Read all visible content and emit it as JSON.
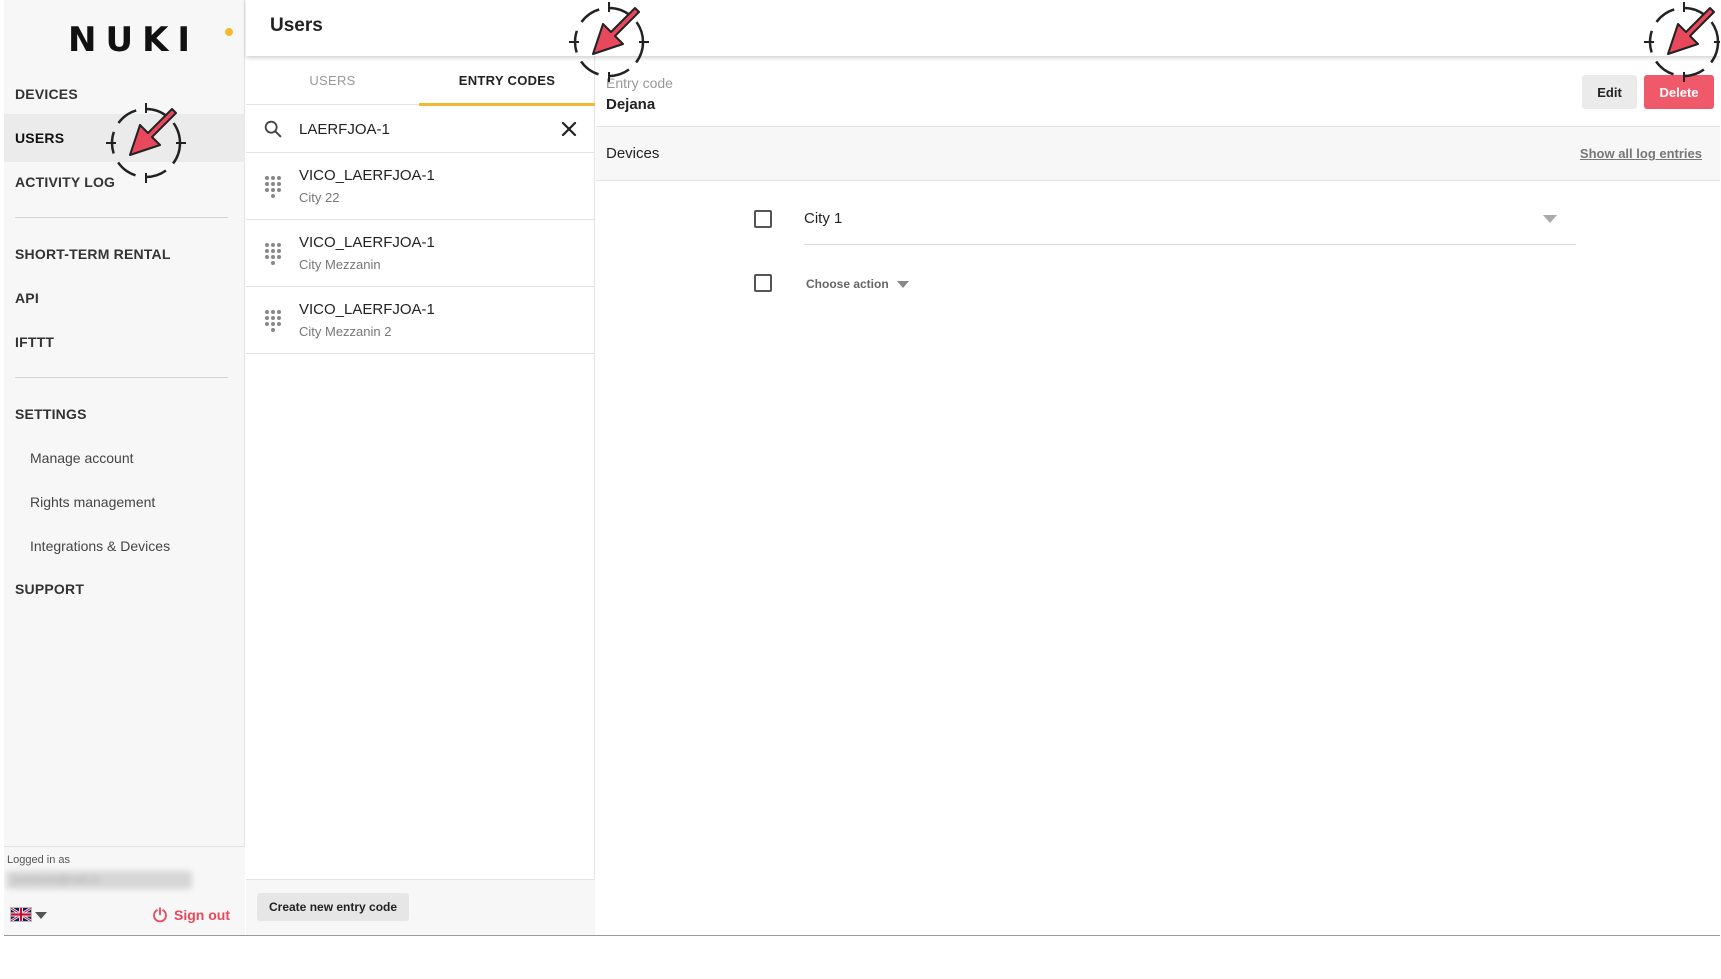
{
  "app": {
    "logo": "NUKI"
  },
  "sidebar": {
    "items": [
      {
        "label": "DEVICES",
        "active": false
      },
      {
        "label": "USERS",
        "active": true
      },
      {
        "label": "ACTIVITY LOG",
        "active": false
      },
      {
        "label": "SHORT-TERM RENTAL",
        "active": false
      },
      {
        "label": "API",
        "active": false
      },
      {
        "label": "IFTTT",
        "active": false
      },
      {
        "label": "SETTINGS",
        "active": false
      },
      {
        "label": "SUPPORT",
        "active": false
      }
    ],
    "settings_items": [
      {
        "label": "Manage account"
      },
      {
        "label": "Rights management"
      },
      {
        "label": "Integrations & Devices"
      }
    ],
    "footer": {
      "logged_in_label": "Logged in as",
      "logged_in_user": "someone@nuki.io",
      "language_icon": "uk-flag-icon",
      "sign_out_label": "Sign out"
    }
  },
  "header": {
    "title": "Users"
  },
  "tabs": [
    {
      "label": "USERS",
      "active": false
    },
    {
      "label": "ENTRY CODES",
      "active": true
    }
  ],
  "search": {
    "value": "LAERFJOA-1",
    "icon": "search-icon",
    "clear_icon": "close-icon"
  },
  "entry_codes": [
    {
      "name": "VICO_LAERFJOA-1",
      "location": "City 22"
    },
    {
      "name": "VICO_LAERFJOA-1",
      "location": "City Mezzanin"
    },
    {
      "name": "VICO_LAERFJOA-1",
      "location": "City Mezzanin 2"
    }
  ],
  "create_button": {
    "label": "Create new entry code"
  },
  "detail": {
    "entry_code_label": "Entry code",
    "entry_code_value": "Dejana",
    "edit_label": "Edit",
    "delete_label": "Delete",
    "devices_label": "Devices",
    "log_link": "Show all log entries",
    "device_name": "City 1",
    "choose_action": "Choose action"
  },
  "colors": {
    "accent": "#f5b833",
    "delete": "#f0596a",
    "sign_out": "#e8485c",
    "marker_arrow": "#e8485c"
  }
}
